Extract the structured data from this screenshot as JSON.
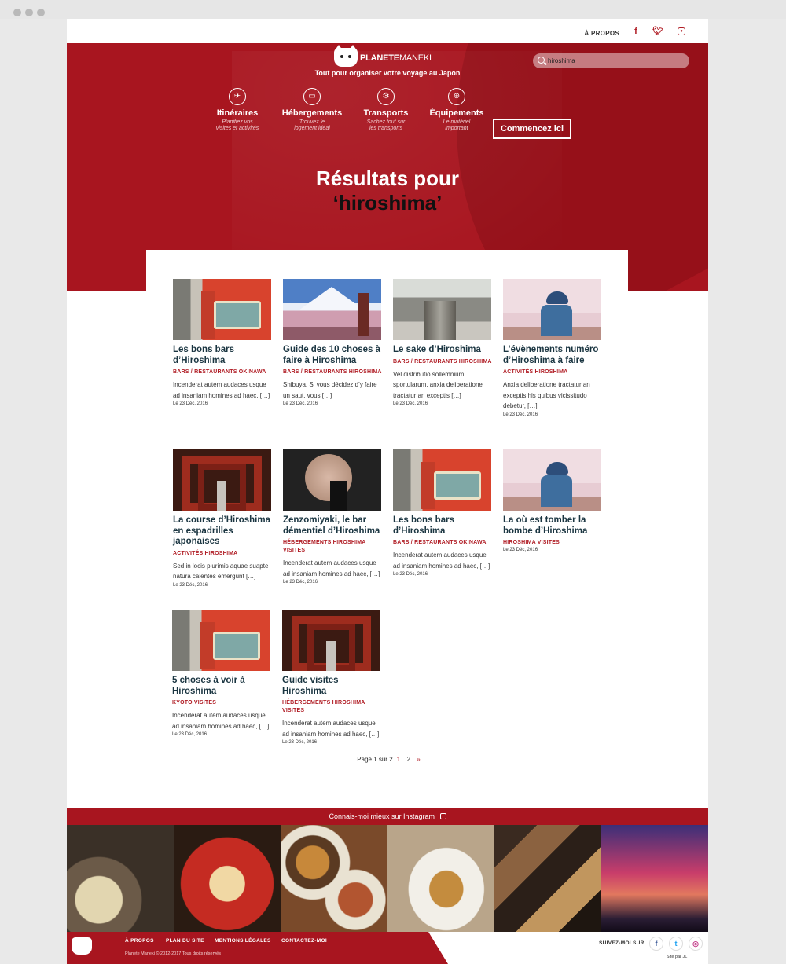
{
  "topbar": {
    "apropos": "À PROPOS",
    "social": [
      "f",
      "t",
      "ig"
    ]
  },
  "brand": {
    "name_bold": "PLANETE",
    "name_light": "MANEKI",
    "tagline": "Tout pour organiser votre voyage au Japon"
  },
  "search": {
    "value": "hiroshima"
  },
  "nav": [
    {
      "label": "Itinéraires",
      "sub": "Planifiez vos\nvisites et activités",
      "icon": "map-icon"
    },
    {
      "label": "Hébergements",
      "sub": "Trouvez le\nlogement idéal",
      "icon": "bed-icon"
    },
    {
      "label": "Transports",
      "sub": "Sachez tout sur\nles transports",
      "icon": "train-icon"
    },
    {
      "label": "Équipements",
      "sub": "Le matériel\nimportant",
      "icon": "cart-icon"
    }
  ],
  "cta": "Commencez ici",
  "results": {
    "line1": "Résultats pour",
    "query": "‘hiroshima’"
  },
  "posts": [
    {
      "title": "Les bons bars d’Hiroshima",
      "cats": "BARS / RESTAURANTS OKINAWA",
      "excerpt": "Incenderat autem audaces usque ad insaniam homines ad haec, […]",
      "date": "Le 23 Déc, 2016",
      "thumb": "train"
    },
    {
      "title": "Guide des 10 choses à faire à Hiroshima",
      "cats": "BARS / RESTAURANTS HIROSHIMA",
      "excerpt": "Shibuya. Si vous décidez d’y faire un saut, vous […]",
      "date": "Le 23 Déc, 2016",
      "thumb": "fuji"
    },
    {
      "title": "Le sake d’Hiroshima",
      "cats": "BARS / RESTAURANTS HIROSHIMA",
      "excerpt": "Vel distributio sollemnium sportularum, anxia deliberatione tractatur an exceptis […]",
      "date": "Le 23 Déc, 2016",
      "thumb": "street"
    },
    {
      "title": "L’évènements numéro d’Hiroshima à faire",
      "cats": "ACTIVITÉS HIROSHIMA",
      "excerpt": "Anxia deliberatione tractatur an exceptis his quibus vicissitudo debetur, […]",
      "date": "Le 23 Déc, 2016",
      "thumb": "kid"
    },
    {
      "title": "La course d’Hiroshima en espadrilles japonaises",
      "cats": "ACTIVITÉS HIROSHIMA",
      "excerpt": "Sed in locis plurimis aquae suapte natura calentes emergunt […]",
      "date": "Le 23 Déc, 2016",
      "thumb": "torii"
    },
    {
      "title": "Zenzomiyaki, le bar démentiel d’Hiroshima",
      "cats": "HÉBERGEMENTS HIROSHIMA VISITES",
      "excerpt": "Incenderat autem audaces usque ad insaniam homines ad haec, […]",
      "date": "Le 23 Déc, 2016",
      "thumb": "umb"
    },
    {
      "title": "Les bons bars d’Hiroshima",
      "cats": "BARS / RESTAURANTS OKINAWA",
      "excerpt": "Incenderat autem audaces usque ad insaniam homines ad haec, […]",
      "date": "Le 23 Déc, 2016",
      "thumb": "train"
    },
    {
      "title": "La où est tomber la bombe d’Hiroshima",
      "cats": "HIROSHIMA VISITES",
      "excerpt": "",
      "date": "Le 23 Déc, 2016",
      "thumb": "kid"
    },
    {
      "title": "5 choses à voir à Hiroshima",
      "cats": "KYOTO VISITES",
      "excerpt": "Incenderat autem audaces usque ad insaniam homines ad haec, […]",
      "date": "Le 23 Déc, 2016",
      "thumb": "train"
    },
    {
      "title": "Guide visites Hiroshima",
      "cats": "HÉBERGEMENTS HIROSHIMA VISITES",
      "excerpt": "Incenderat autem audaces usque ad insaniam homines ad haec, […]",
      "date": "Le 23 Déc, 2016",
      "thumb": "torii"
    }
  ],
  "pagination": {
    "label": "Page 1 sur 2",
    "pages": [
      "1",
      "2"
    ],
    "next": "»"
  },
  "instagram": {
    "title": "Connais-moi mieux sur Instagram"
  },
  "footer": {
    "links": [
      "À PROPOS",
      "PLAN DU SITE",
      "MENTIONS LÉGALES",
      "CONTACTEZ-MOI"
    ],
    "copyright": "Planete Maneki © 2012-2017 Tous droits réservés",
    "follow": "SUIVEZ-MOI SUR",
    "credit": "Site par JL"
  },
  "colors": {
    "brand_red": "#a8151f",
    "title_dark": "#1a3541"
  }
}
